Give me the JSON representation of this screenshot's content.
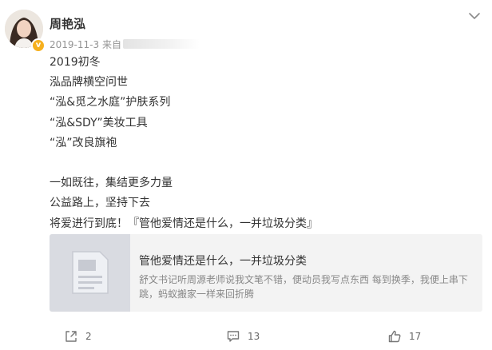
{
  "post": {
    "username": "周艳泓",
    "date": "2019-11-3",
    "source_prefix": "来自",
    "content_lines": [
      "2019初冬",
      "泓品牌横空问世",
      "“泓&觅之水庭”护肤系列",
      "“泓&SDY”美妆工具",
      "“泓”改良旗袍",
      "",
      "一如既往，集结更多力量",
      "公益路上，坚持下去",
      "将爱进行到底！『管他爱情还是什么，一并垃圾分类』"
    ]
  },
  "card": {
    "title": "管他爱情还是什么，一并垃圾分类",
    "description": "舒文书记听周源老师说我文笔不错，便动员我写点东西 每到换季，我便上串下跳，蚂蚁搬家一样来回折腾"
  },
  "footer": {
    "share_count": "2",
    "comment_count": "13",
    "like_count": "17"
  },
  "icons": {
    "verified": "verified-badge-icon",
    "menu": "chevron-down-icon",
    "share": "share-icon",
    "comment": "comment-icon",
    "like": "thumbs-up-icon",
    "article": "article-icon"
  },
  "colors": {
    "verified_badge": "#f6b01e",
    "card_background": "#f3f3f3",
    "card_thumb": "#d9dbe1",
    "meta_text": "#939393"
  }
}
